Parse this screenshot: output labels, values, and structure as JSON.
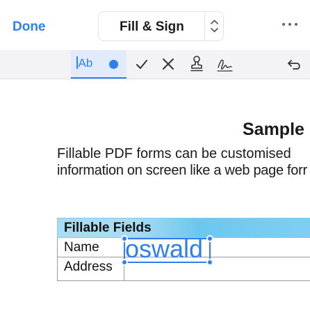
{
  "header": {
    "done_label": "Done",
    "title": "Fill & Sign",
    "switcher_icon": "chevron-up-down-icon",
    "more_icon": "ellipsis-icon"
  },
  "toolbar": {
    "text_tool_label": "Ab",
    "tools": [
      {
        "name": "text-tool",
        "icon": "text-cursor-icon",
        "active": true
      },
      {
        "name": "color",
        "icon": "color-dot-icon",
        "color": "#2f7ff0"
      },
      {
        "name": "checkmark",
        "icon": "checkmark-icon"
      },
      {
        "name": "cross",
        "icon": "cross-icon"
      },
      {
        "name": "stamp",
        "icon": "stamp-icon"
      },
      {
        "name": "signature",
        "icon": "signature-icon"
      },
      {
        "name": "undo",
        "icon": "undo-icon"
      }
    ]
  },
  "document": {
    "title": "Sample",
    "line1": "Fillable PDF forms can be customised",
    "line2": "information on screen like a web page forr",
    "table_header": "Fillable Fields",
    "rows": [
      {
        "label": "Name",
        "value": ""
      },
      {
        "label": "Address",
        "value": ""
      }
    ],
    "active_field_value": "oswald"
  },
  "colors": {
    "accent": "#2f7ff0",
    "toolbar_bg": "#f3f3f6",
    "table_header": "#7fcff3"
  }
}
